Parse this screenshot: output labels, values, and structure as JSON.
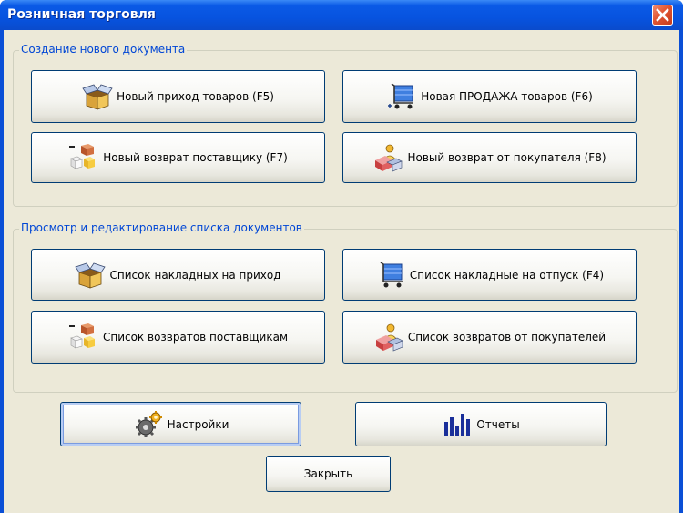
{
  "window": {
    "title": "Розничная торговля"
  },
  "group_new": {
    "legend": "Создание нового документа",
    "buttons": {
      "new_receipt": "Новый приход товаров (F5)",
      "new_sale": "Новая ПРОДАЖА товаров (F6)",
      "new_supplier_return": "Новый возврат поставщику (F7)",
      "new_customer_return": "Новый возврат от покупателя (F8)"
    }
  },
  "group_list": {
    "legend": "Просмотр и редактирование списка документов",
    "buttons": {
      "receipt_list": "Список накладных на приход",
      "dispatch_list": "Список накладные на отпуск (F4)",
      "supplier_return_list": "Список возвратов поставщикам",
      "customer_return_list": "Список возвратов от покупателей"
    }
  },
  "bottom": {
    "settings": "Настройки",
    "reports": "Отчеты",
    "close": "Закрыть"
  },
  "icons": {
    "box": "open-box-icon",
    "cart": "shopping-cart-icon",
    "return_supplier": "boxes-return-icon",
    "return_customer": "customer-return-icon",
    "settings": "gears-icon",
    "reports": "bar-chart-icon"
  }
}
